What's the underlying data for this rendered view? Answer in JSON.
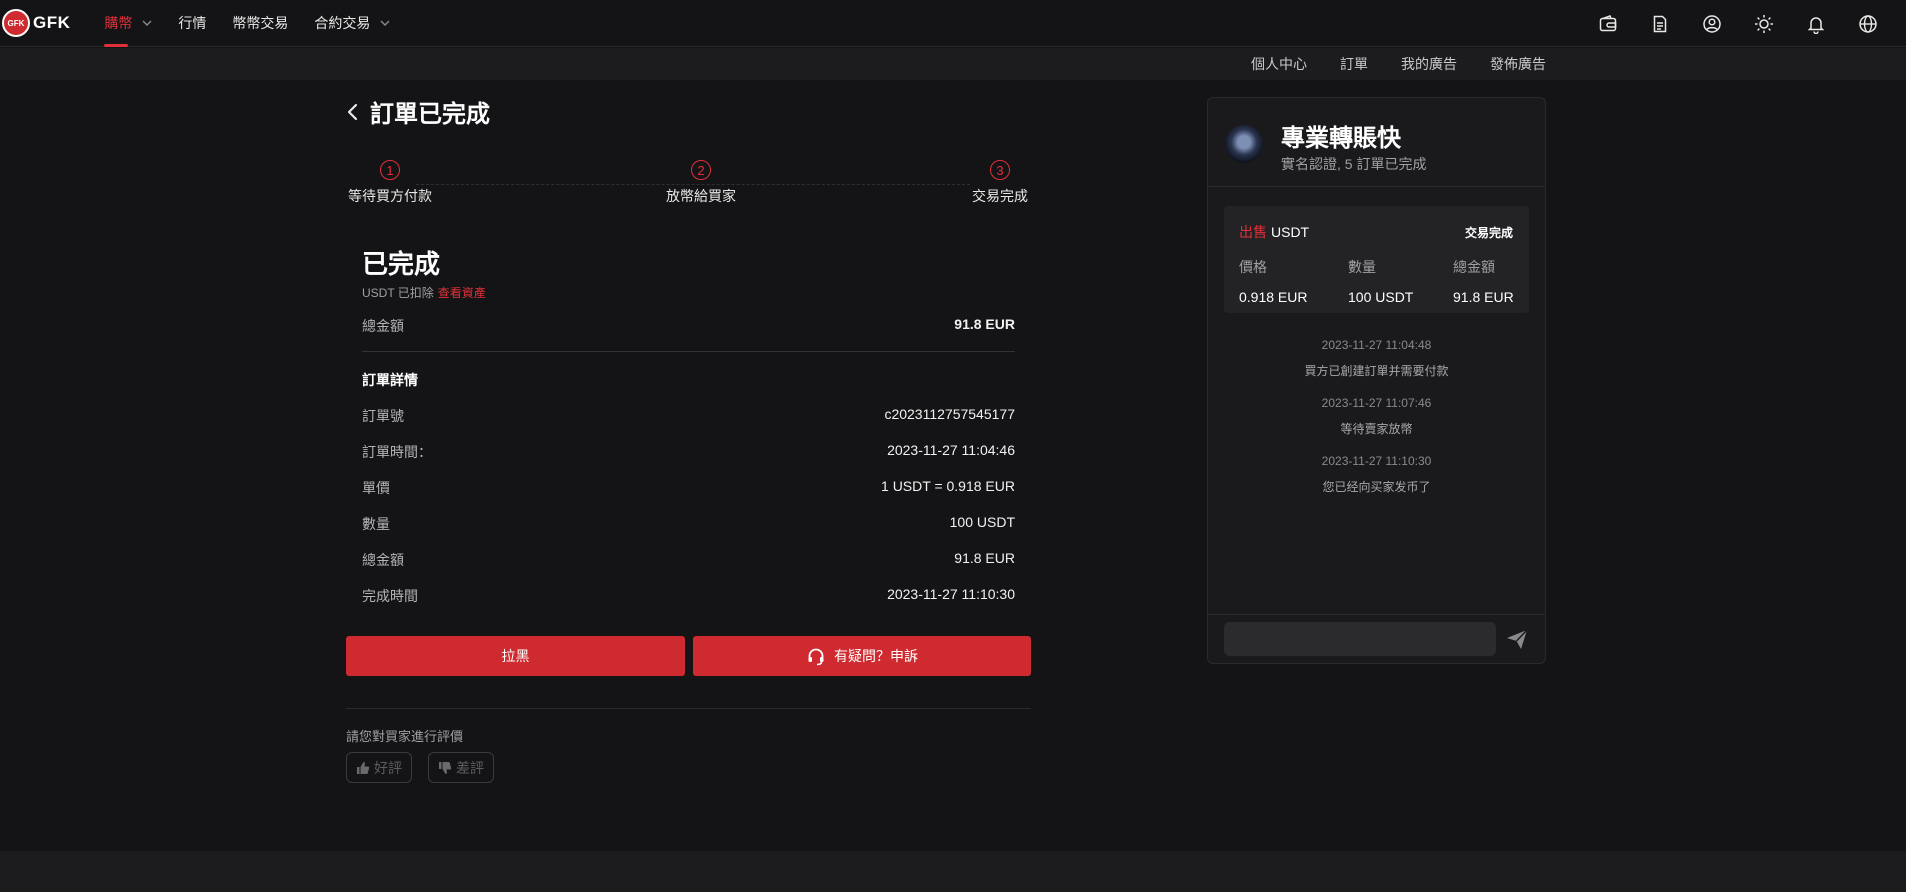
{
  "brand": {
    "logo_mark": "GFK",
    "name": "GFK"
  },
  "nav": {
    "items": [
      {
        "label": "購幣",
        "active": true,
        "dropdown": true
      },
      {
        "label": "行情",
        "active": false,
        "dropdown": false
      },
      {
        "label": "幣幣交易",
        "active": false,
        "dropdown": false
      },
      {
        "label": "合約交易",
        "active": false,
        "dropdown": true
      }
    ],
    "right_icons": [
      "wallet-icon",
      "document-icon",
      "user-icon",
      "sun-icon",
      "bell-icon",
      "globe-icon"
    ]
  },
  "subnav": {
    "items": [
      "個人中心",
      "訂單",
      "我的廣告",
      "發佈廣告"
    ]
  },
  "order": {
    "page_title": "訂單已完成",
    "steps": [
      {
        "num": "1",
        "label": "等待買方付款"
      },
      {
        "num": "2",
        "label": "放幣給買家"
      },
      {
        "num": "3",
        "label": "交易完成"
      }
    ],
    "status": "已完成",
    "status_sub": "USDT 已扣除",
    "view_assets": "查看資產",
    "total_label": "總金額",
    "total_value": "91.8 EUR",
    "details_title": "訂單詳情",
    "details": [
      {
        "label": "訂單號",
        "value": "c2023112757545177"
      },
      {
        "label": "訂單時間：",
        "value": "2023-11-27 11:04:46"
      },
      {
        "label": "單價",
        "value": "1 USDT = 0.918 EUR"
      },
      {
        "label": "數量",
        "value": "100 USDT"
      },
      {
        "label": "總金額",
        "value": "91.8 EUR"
      },
      {
        "label": "完成時間",
        "value": "2023-11-27 11:10:30"
      }
    ],
    "block_button": "拉黑",
    "complain_button": "有疑問？申訴",
    "rate_prompt": "請您對買家進行評價",
    "good_label": "好評",
    "bad_label": "差評"
  },
  "chat": {
    "seller_name": "專業轉賬快",
    "seller_sub": "實名認證, 5 訂單已完成",
    "card": {
      "side": "出售",
      "coin": "USDT",
      "status": "交易完成",
      "price_label": "價格",
      "price_value": "0.918 EUR",
      "qty_label": "數量",
      "qty_value": "100 USDT",
      "total_label": "總金額",
      "total_value": "91.8 EUR"
    },
    "timeline": [
      {
        "time": "2023-11-27 11:04:48",
        "message": "買方已創建訂單并需要付款"
      },
      {
        "time": "2023-11-27 11:07:46",
        "message": "等待賣家放幣"
      },
      {
        "time": "2023-11-27 11:10:30",
        "message": "您已经向买家发币了"
      }
    ],
    "input_value": "",
    "input_placeholder": ""
  },
  "colors": {
    "accent": "#e0303a",
    "button": "#cf2a2f",
    "background": "#141416",
    "panel": "#1a1a1c"
  }
}
